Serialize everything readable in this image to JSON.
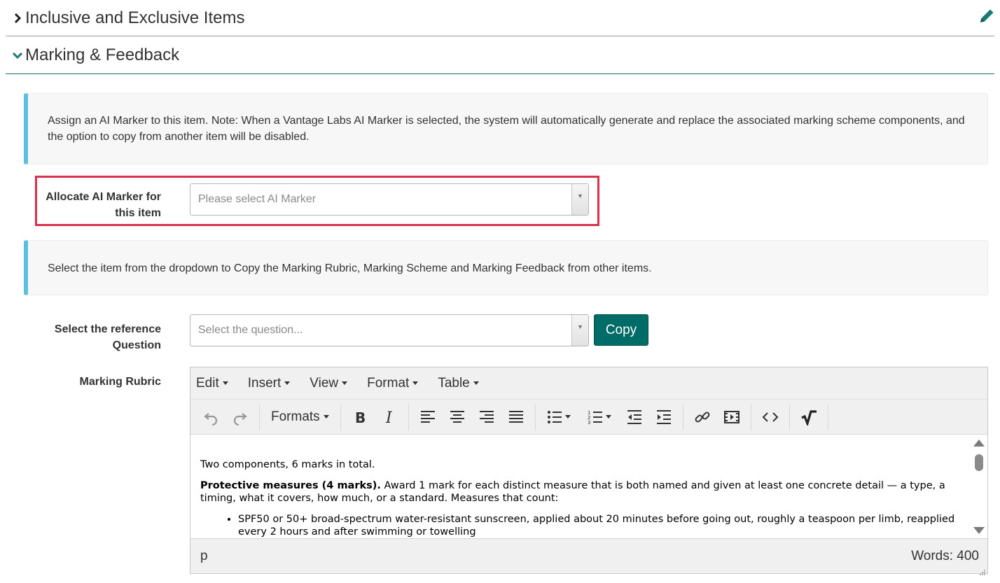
{
  "sections": {
    "inclusive": {
      "title": "Inclusive and Exclusive Items",
      "icon": "chevron-right-icon",
      "edit_icon": "pencil-icon"
    },
    "marking": {
      "title": "Marking & Feedback",
      "icon": "chevron-down-icon"
    }
  },
  "colors": {
    "accent": "#006c67",
    "info_border": "#5bc0de",
    "highlight": "#d9304f"
  },
  "alerts": {
    "ai_note": "Assign an AI Marker to this item. Note: When a Vantage Labs AI Marker is selected, the system will automatically generate and replace the associated marking scheme components, and the option to copy from another item will be disabled.",
    "copy_note": "Select the item from the dropdown to Copy the Marking Rubric, Marking Scheme and Marking Feedback from other items."
  },
  "ai_marker": {
    "label_line1": "Allocate AI Marker for",
    "label_line2": "this item",
    "placeholder": "Please select AI Marker"
  },
  "reference": {
    "label_line1": "Select the reference",
    "label_line2": "Question",
    "placeholder": "Select the question...",
    "copy_button": "Copy"
  },
  "rubric": {
    "label": "Marking Rubric",
    "menu": [
      "Edit",
      "Insert",
      "View",
      "Format",
      "Table"
    ],
    "formats_label": "Formats",
    "content": {
      "intro": "Two components, 6 marks in total.",
      "bold_heading": "Protective measures (4 marks).",
      "paragraph": " Award 1 mark for each distinct measure that is both named and given at least one concrete detail — a type, a timing, what it covers, how much, or a standard. Measures that count:",
      "bullet1": "SPF50 or 50+ broad-spectrum water-resistant sunscreen, applied about 20 minutes before going out, roughly a teaspoon per limb, reapplied every 2 hours and after swimming or towelling"
    },
    "status_path": "p",
    "word_count": "Words: 400"
  }
}
